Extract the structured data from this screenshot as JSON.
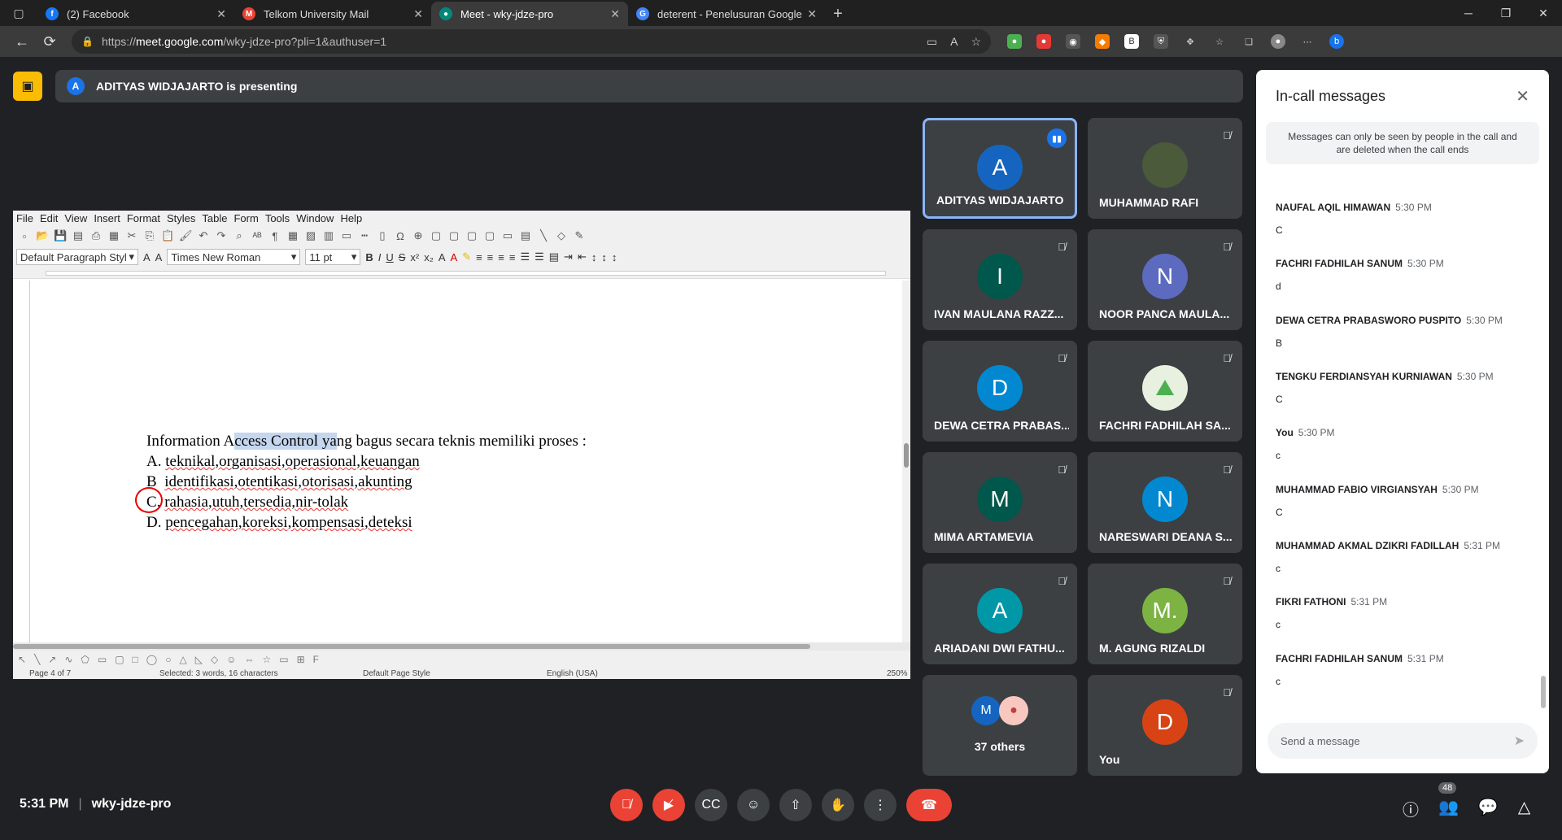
{
  "browser": {
    "tabs": [
      {
        "title": "(2) Facebook",
        "icon": "facebook-icon",
        "color": "#1877f2",
        "glyph": "f"
      },
      {
        "title": "Telkom University Mail",
        "icon": "gmail-icon",
        "color": "#ea4335",
        "glyph": "M"
      },
      {
        "title": "Meet - wky-jdze-pro",
        "icon": "meet-icon",
        "color": "#00897b",
        "glyph": "●"
      },
      {
        "title": "deterent - Penelusuran Google",
        "icon": "google-icon",
        "color": "#4285f4",
        "glyph": "G"
      }
    ],
    "url_prefix": "https://",
    "url_host": "meet.google.com",
    "url_path": "/wky-jdze-pro?pli=1&authuser=1"
  },
  "meet": {
    "presenting_initial": "A",
    "presenting_text": "ADITYAS WIDJAJARTO is presenting",
    "time": "5:31 PM",
    "separator": "|",
    "meeting_code": "wky-jdze-pro",
    "participant_count": "48"
  },
  "writer": {
    "menu": [
      "File",
      "Edit",
      "View",
      "Insert",
      "Format",
      "Styles",
      "Table",
      "Form",
      "Tools",
      "Window",
      "Help"
    ],
    "para_style": "Default Paragraph Styl",
    "font_name": "Times New Roman",
    "font_size": "11 pt",
    "doc_lines": [
      {
        "pre": "Information A",
        "hl": "ccess Control ya",
        "post": "ng bagus secara teknis memiliki proses :"
      },
      {
        "label": "A.",
        "text": "teknikal,organisasi,operasional,keuangan"
      },
      {
        "label": "B",
        "text": "identifikasi,otentikasi,otorisasi,akunting"
      },
      {
        "label": "C.",
        "text": "rahasia,utuh,tersedia,nir-tolak"
      },
      {
        "label": "D.",
        "text": "pencegahan,koreksi,kompensasi,deteksi"
      }
    ],
    "status_page": "Page 4 of 7",
    "status_selected": "Selected: 3 words, 16 characters",
    "status_style": "Default Page Style",
    "status_lang": "English (USA)",
    "status_zoom": "250%"
  },
  "tiles": [
    {
      "name": "ADITYAS WIDJAJARTO",
      "initial": "A",
      "color": "#1565c0",
      "speaking": true
    },
    {
      "name": "MUHAMMAD RAFI",
      "initial": "",
      "color": "#4a5a3a",
      "photo": true
    },
    {
      "name": "IVAN MAULANA RAZZ...",
      "initial": "I",
      "color": "#00574b"
    },
    {
      "name": "NOOR PANCA MAULA...",
      "initial": "N",
      "color": "#5c6bc0"
    },
    {
      "name": "DEWA CETRA PRABAS...",
      "initial": "D",
      "color": "#0288d1"
    },
    {
      "name": "FACHRI FADHILAH SA...",
      "initial": "",
      "color": "#e8f0e0",
      "photo": true
    },
    {
      "name": "MIMA ARTAMEVIA",
      "initial": "M",
      "color": "#00574b"
    },
    {
      "name": "NARESWARI DEANA S...",
      "initial": "N",
      "color": "#0288d1"
    },
    {
      "name": "ARIADANI DWI FATHU...",
      "initial": "A",
      "color": "#0097a7"
    },
    {
      "name": "M. AGUNG RIZALDI",
      "initial": "M.",
      "color": "#7cb342"
    },
    {
      "name": "37 others",
      "initial": "M",
      "color": "#1565c0",
      "others": true
    },
    {
      "name": "You",
      "initial": "D",
      "color": "#d84315"
    }
  ],
  "chat": {
    "title": "In-call messages",
    "note": "Messages can only be seen by people in the call and are deleted when the call ends",
    "messages": [
      {
        "who": "NAUFAL AQIL HIMAWAN",
        "time": "5:30 PM",
        "text": "C"
      },
      {
        "who": "FACHRI FADHILAH SANUM",
        "time": "5:30 PM",
        "text": "d"
      },
      {
        "who": "DEWA CETRA PRABASWORO PUSPITO",
        "time": "5:30 PM",
        "text": "B"
      },
      {
        "who": "TENGKU FERDIANSYAH KURNIAWAN",
        "time": "5:30 PM",
        "text": "C"
      },
      {
        "who": "You",
        "time": "5:30 PM",
        "text": "c"
      },
      {
        "who": "MUHAMMAD FABIO VIRGIANSYAH",
        "time": "5:30 PM",
        "text": "C"
      },
      {
        "who": "MUHAMMAD AKMAL DZIKRI FADILLAH",
        "time": "5:31 PM",
        "text": "c"
      },
      {
        "who": "FIKRI FATHONI",
        "time": "5:31 PM",
        "text": "c"
      },
      {
        "who": "FACHRI FADHILAH SANUM",
        "time": "5:31 PM",
        "text": "c"
      }
    ],
    "placeholder": "Send a message"
  }
}
